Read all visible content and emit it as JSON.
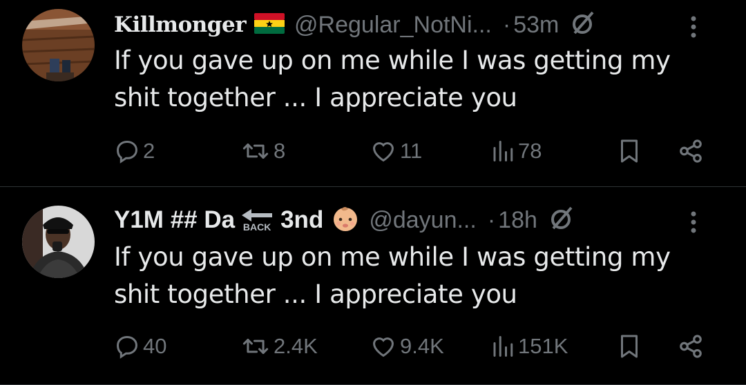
{
  "tweets": [
    {
      "display_name": "Killmonger",
      "flag_icon": "ghana-flag-icon",
      "handle": "@Regular_NotNi...",
      "separator": "·",
      "time": "53m",
      "text": "If you gave up on me while I was getting my shit together ... I appreciate you",
      "stats": {
        "replies": "2",
        "reposts": "8",
        "likes": "11",
        "views": "78"
      }
    },
    {
      "display_name_part1": "Y1M ## Da",
      "back_label": "BACK",
      "display_name_part2": "3nd",
      "emoji_icon": "baby-emoji-icon",
      "handle": "@dayun...",
      "separator": "·",
      "time": "18h",
      "text": "If you gave up on me while I was getting my shit together ... I appreciate you",
      "stats": {
        "replies": "40",
        "reposts": "2.4K",
        "likes": "9.4K",
        "views": "151K"
      }
    }
  ],
  "colors": {
    "background": "#000000",
    "text": "#e7e9ea",
    "muted": "#71767b",
    "divider": "#2f3336"
  }
}
